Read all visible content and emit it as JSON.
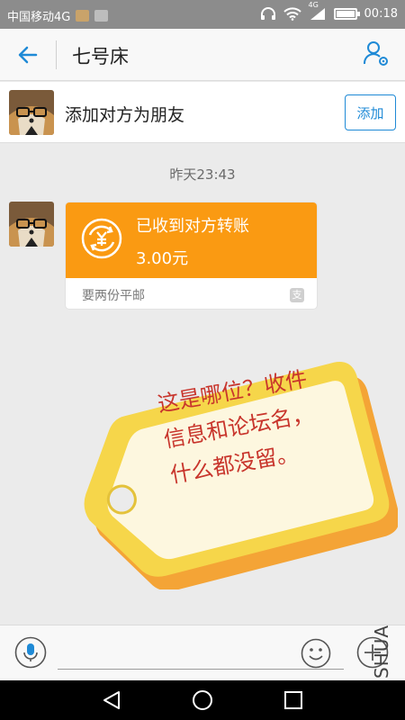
{
  "status_bar": {
    "carrier": "中国移动4G",
    "network": "4G",
    "time": "00:18",
    "battery_level": 0.9
  },
  "header": {
    "title": "七号床",
    "back_icon": "back-arrow-icon",
    "profile_icon": "profile-settings-icon"
  },
  "friend_bar": {
    "text": "添加对方为朋友",
    "add_label": "添加"
  },
  "chat": {
    "timestamp": "昨天23:43",
    "transfer": {
      "status": "已收到对方转账",
      "amount": "3.00元",
      "note": "要两份平邮",
      "provider_badge": "支"
    },
    "sticker": {
      "lines": [
        "这是哪位？收件",
        "信息和论坛名，",
        "什么都没留。"
      ]
    }
  },
  "input_bar": {
    "mic_icon": "microphone-icon",
    "emoji_icon": "emoji-icon",
    "plus_icon": "plus-icon"
  },
  "watermark": "SHUA",
  "colors": {
    "accent_blue": "#1f8ad6",
    "transfer_orange": "#fa9a12",
    "sticker_yellow": "#f6d64a",
    "sticker_orange": "#f4a436",
    "sticker_text": "#c8352c"
  }
}
